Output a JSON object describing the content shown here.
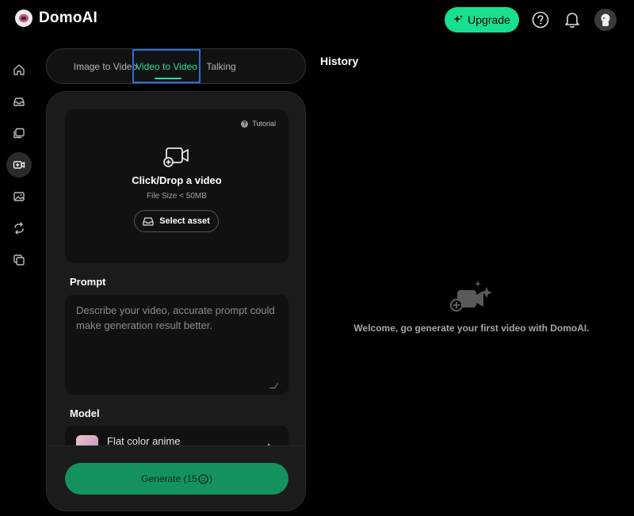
{
  "app": {
    "name": "DomoAI"
  },
  "header": {
    "upgrade_label": "Upgrade",
    "icons": [
      "help-icon",
      "bell-icon",
      "user-avatar"
    ]
  },
  "sidebar": {
    "items": [
      {
        "icon": "home-icon",
        "active": false
      },
      {
        "icon": "inbox-icon",
        "active": false
      },
      {
        "icon": "gallery-icon",
        "active": false
      },
      {
        "icon": "video-icon",
        "active": true
      },
      {
        "icon": "image-icon",
        "active": false
      },
      {
        "icon": "cycle-icon",
        "active": false
      },
      {
        "icon": "layers-icon",
        "active": false
      }
    ]
  },
  "tabs": [
    {
      "label": "Image to Video",
      "active": false
    },
    {
      "label": "Video to Video",
      "active": true
    },
    {
      "label": "Talking",
      "active": false
    }
  ],
  "upload": {
    "tutorial_label": "Tutorial",
    "title": "Click/Drop a video",
    "subtitle": "File Size < 50MB",
    "select_label": "Select asset"
  },
  "prompt": {
    "label": "Prompt",
    "placeholder": "Describe your video, accurate prompt could make generation result better.",
    "value": ""
  },
  "model": {
    "label": "Model",
    "selected": "Flat color anime"
  },
  "generate": {
    "label": "Generate (15",
    "suffix": ")"
  },
  "history": {
    "title": "History",
    "empty_message": "Welcome, go generate your first video with DomoAI."
  },
  "colors": {
    "accent": "#19e08f",
    "generate_bg": "#14925e",
    "active_tab_border": "#2b6fd6",
    "panel_bg": "#1b1b1b"
  }
}
